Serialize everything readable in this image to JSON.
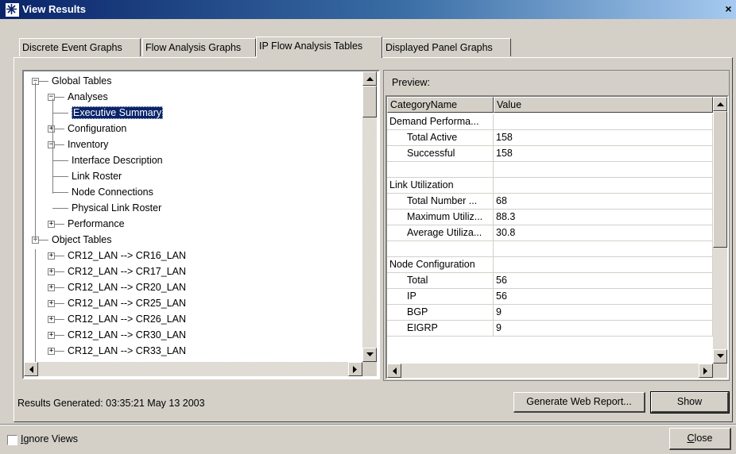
{
  "window": {
    "title": "View Results",
    "close_glyph": "×"
  },
  "tabs": [
    {
      "label": "Discrete Event Graphs"
    },
    {
      "label": "Flow Analysis Graphs"
    },
    {
      "label": "IP Flow Analysis Tables",
      "active": true
    },
    {
      "label": "Displayed Panel Graphs"
    }
  ],
  "tree": {
    "items": [
      {
        "label": "Global Tables",
        "level": 0,
        "expander": "−"
      },
      {
        "label": "Analyses",
        "level": 1,
        "expander": "−"
      },
      {
        "label": "Executive Summary",
        "level": 2,
        "selected": true
      },
      {
        "label": "Configuration",
        "level": 1,
        "expander": "+"
      },
      {
        "label": "Inventory",
        "level": 1,
        "expander": "−"
      },
      {
        "label": "Interface Description",
        "level": 2
      },
      {
        "label": "Link Roster",
        "level": 2
      },
      {
        "label": "Node Connections",
        "level": 2
      },
      {
        "label": "Physical Link Roster",
        "level": 2
      },
      {
        "label": "Performance",
        "level": 1,
        "expander": "+"
      },
      {
        "label": "Object Tables",
        "level": 0,
        "expander": "−"
      },
      {
        "label": "CR12_LAN --> CR16_LAN",
        "level": 1,
        "expander": "+"
      },
      {
        "label": "CR12_LAN --> CR17_LAN",
        "level": 1,
        "expander": "+"
      },
      {
        "label": "CR12_LAN --> CR20_LAN",
        "level": 1,
        "expander": "+"
      },
      {
        "label": "CR12_LAN --> CR25_LAN",
        "level": 1,
        "expander": "+"
      },
      {
        "label": "CR12_LAN --> CR26_LAN",
        "level": 1,
        "expander": "+"
      },
      {
        "label": "CR12_LAN --> CR30_LAN",
        "level": 1,
        "expander": "+"
      },
      {
        "label": "CR12_LAN --> CR33_LAN",
        "level": 1,
        "expander": "+"
      }
    ]
  },
  "preview": {
    "label": "Preview:",
    "columns": [
      "CategoryName",
      "Value"
    ],
    "rows": [
      {
        "name": "Demand Performa...",
        "value": "",
        "indent": false
      },
      {
        "name": "Total Active",
        "value": "158",
        "indent": true
      },
      {
        "name": "Successful",
        "value": "158",
        "indent": true
      },
      {
        "name": "",
        "value": "",
        "indent": false
      },
      {
        "name": "Link Utilization",
        "value": "",
        "indent": false
      },
      {
        "name": "Total Number ...",
        "value": "68",
        "indent": true
      },
      {
        "name": "Maximum Utiliz...",
        "value": "88.3",
        "indent": true
      },
      {
        "name": "Average Utiliza...",
        "value": "30.8",
        "indent": true
      },
      {
        "name": "",
        "value": "",
        "indent": false
      },
      {
        "name": "Node Configuration",
        "value": "",
        "indent": false
      },
      {
        "name": "Total",
        "value": "56",
        "indent": true
      },
      {
        "name": "IP",
        "value": "56",
        "indent": true
      },
      {
        "name": "BGP",
        "value": "9",
        "indent": true
      },
      {
        "name": "EIGRP",
        "value": "9",
        "indent": true
      }
    ]
  },
  "status": {
    "generated": "Results Generated: 03:35:21 May 13 2003"
  },
  "buttons": {
    "web_report": "Generate Web Report...",
    "show": "Show",
    "close_accel": "C",
    "close_rest": "lose"
  },
  "ignore_views": {
    "accel": "I",
    "rest": "gnore Views",
    "checked": false
  },
  "colors": {
    "selection": "#0a246a",
    "face": "#d4d0c8",
    "titlebar_start": "#0a246a",
    "titlebar_end": "#a6caf0"
  },
  "icons": [
    "app-icon",
    "close-icon",
    "scroll-up-arrow-icon",
    "scroll-down-arrow-icon",
    "scroll-left-arrow-icon",
    "scroll-right-arrow-icon",
    "tree-expander-icon"
  ]
}
